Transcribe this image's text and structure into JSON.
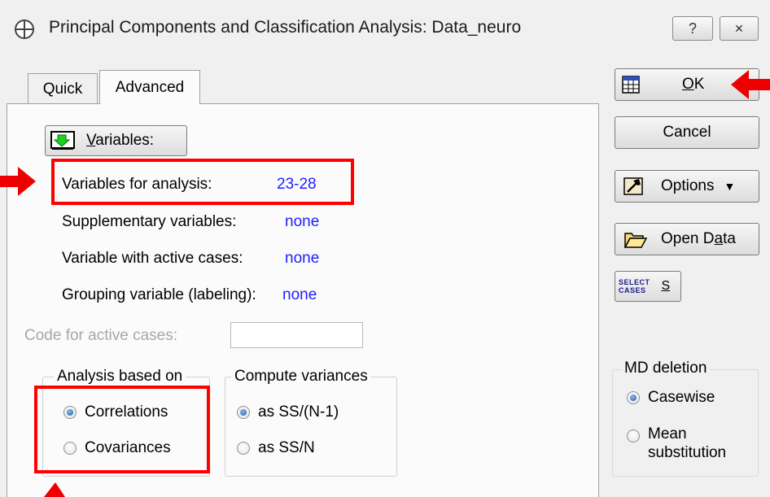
{
  "window": {
    "title": "Principal Components and Classification Analysis: Data_neuro",
    "help_glyph": "?",
    "close_glyph": "✕"
  },
  "tabs": [
    {
      "label": "Quick",
      "active": false
    },
    {
      "label": "Advanced",
      "active": true
    }
  ],
  "variables_button": {
    "label": "Variables:",
    "mnemonic": "V",
    "rest": "ariables:"
  },
  "fields": {
    "variables_for_analysis": {
      "label": "Variables for analysis:",
      "value": "23-28"
    },
    "supplementary_variables": {
      "label": "Supplementary variables:",
      "value": "none"
    },
    "variable_active_cases": {
      "label": "Variable with active cases:",
      "value": "none"
    },
    "grouping_variable": {
      "label": "Grouping variable (labeling):",
      "value": "none"
    },
    "code_active_cases": {
      "label": "Code for active cases:",
      "value": ""
    }
  },
  "analysis_based_on": {
    "legend": "Analysis based on",
    "options": [
      {
        "label": "Correlations",
        "selected": true
      },
      {
        "label": "Covariances",
        "selected": false
      }
    ]
  },
  "compute_variances": {
    "legend": "Compute variances",
    "options": [
      {
        "label": "as SS/(N-1)",
        "selected": true
      },
      {
        "label": "as SS/N",
        "selected": false
      }
    ]
  },
  "side_buttons": {
    "ok": {
      "label": "OK",
      "mnemonic": "O",
      "rest": "K"
    },
    "cancel": {
      "label": "Cancel"
    },
    "options": {
      "label": "Options",
      "arrow": "▼"
    },
    "open_data": {
      "label": "Open Data",
      "pre": "Open D",
      "mnemonic": "a",
      "post": "ta"
    },
    "select_cases": {
      "icon_line1": "SELECT",
      "icon_line2": "CASES",
      "label": "S"
    }
  },
  "md_deletion": {
    "legend": "MD deletion",
    "options": [
      {
        "label": "Casewise",
        "selected": true
      },
      {
        "label": "Mean",
        "label2": "substitution",
        "selected": false
      }
    ]
  },
  "colors": {
    "highlight": "#ff0000",
    "value_text": "#2020ff",
    "window_bg": "#f0f0f0",
    "panel_bg": "#fbfbfb"
  }
}
